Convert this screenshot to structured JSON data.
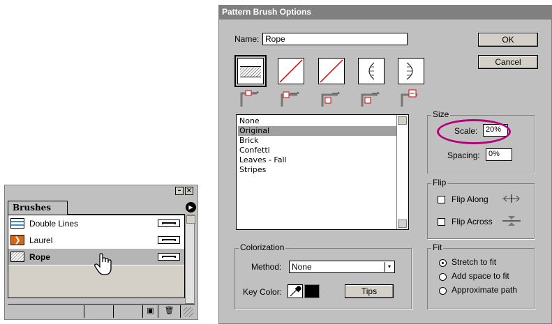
{
  "brushes_panel": {
    "tab_label": "Brushes",
    "items": [
      {
        "label": "Double Lines",
        "swatch": "double-lines"
      },
      {
        "label": "Laurel",
        "swatch": "laurel"
      },
      {
        "label": "Rope",
        "swatch": "rope",
        "selected": true
      }
    ]
  },
  "dialog": {
    "title": "Pattern Brush Options",
    "name_label": "Name:",
    "name_value": "Rope",
    "ok_label": "OK",
    "cancel_label": "Cancel",
    "pattern_list": [
      "None",
      "Original",
      "Brick",
      "Confetti",
      "Leaves - Fall",
      "Stripes"
    ],
    "selected_pattern": "Original",
    "size": {
      "title": "Size",
      "scale_label": "Scale:",
      "scale_value": "20%",
      "spacing_label": "Spacing:",
      "spacing_value": "0%"
    },
    "flip": {
      "title": "Flip",
      "along_label": "Flip Along",
      "across_label": "Flip Across"
    },
    "colorization": {
      "title": "Colorization",
      "method_label": "Method:",
      "method_value": "None",
      "key_color_label": "Key Color:",
      "tips_label": "Tips"
    },
    "fit": {
      "title": "Fit",
      "options": [
        "Stretch to fit",
        "Add space to fit",
        "Approximate path"
      ],
      "selected": "Stretch to fit"
    }
  },
  "colors": {
    "highlight_ellipse": "#b5007c",
    "selection_gray": "#a0a0a0",
    "dialog_bg": "#c0c0c0"
  }
}
